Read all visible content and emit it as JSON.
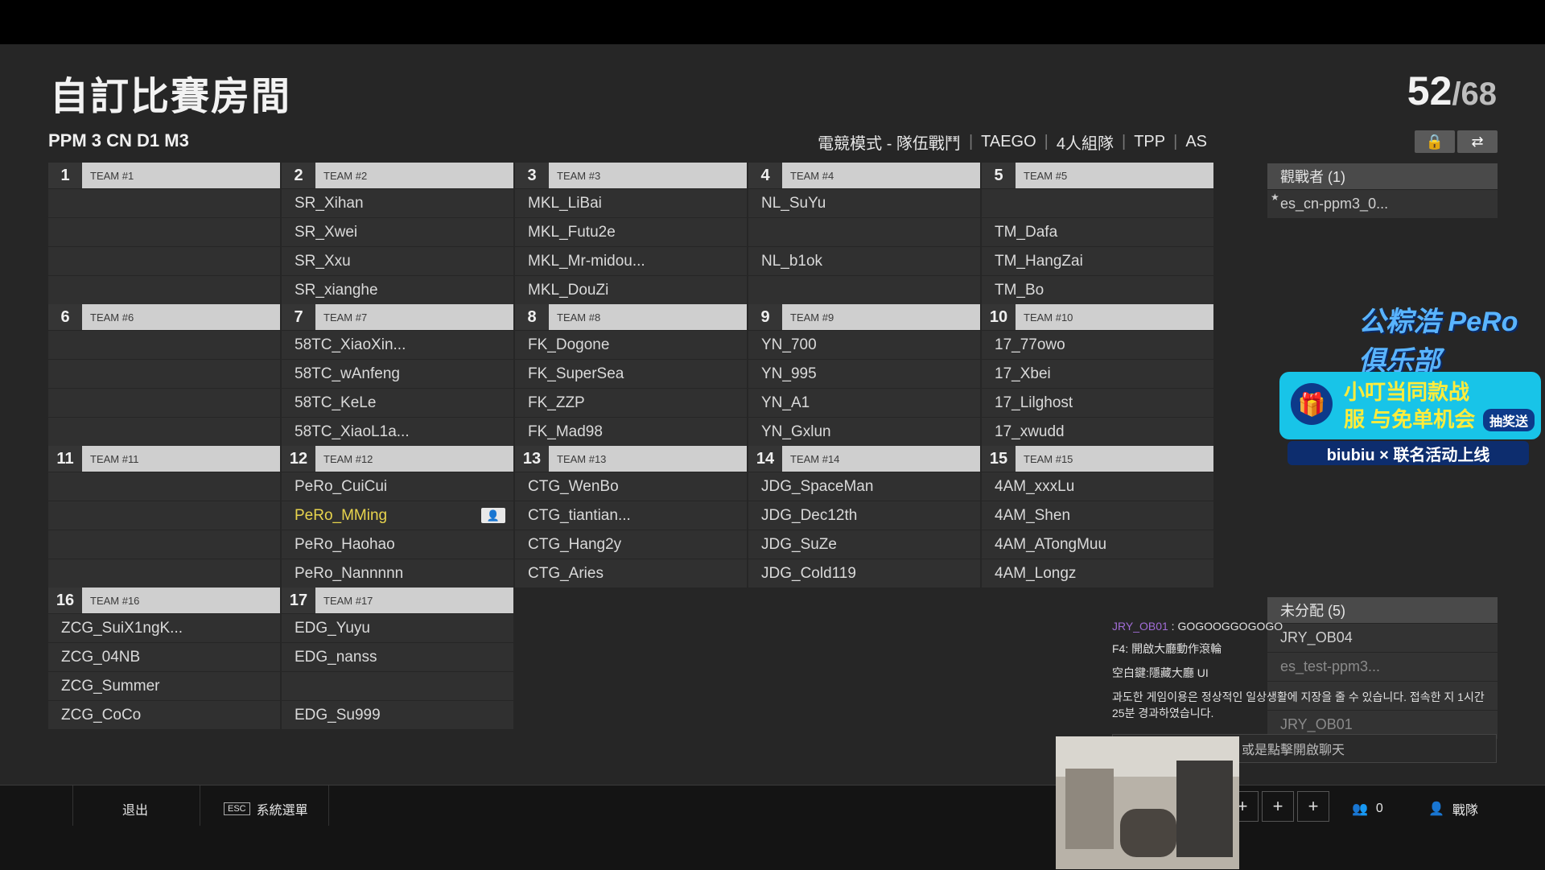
{
  "header": {
    "title": "自訂比賽房間",
    "room_code": "PPM 3 CN D1 M3",
    "player_count": "52",
    "player_max": "/68",
    "mode_items": [
      "電競模式 - 隊伍戰鬥",
      "TAEGO",
      "4人組隊",
      "TPP",
      "AS"
    ]
  },
  "teams": [
    {
      "num": "1",
      "name": "TEAM #1",
      "players": [
        "",
        "",
        "",
        ""
      ]
    },
    {
      "num": "2",
      "name": "TEAM #2",
      "players": [
        "SR_Xihan",
        "SR_Xwei",
        "SR_Xxu",
        "SR_xianghe"
      ]
    },
    {
      "num": "3",
      "name": "TEAM #3",
      "players": [
        "MKL_LiBai",
        "MKL_Futu2e",
        "MKL_Mr-midou...",
        "MKL_DouZi"
      ]
    },
    {
      "num": "4",
      "name": "TEAM #4",
      "players": [
        "NL_SuYu",
        "",
        "NL_b1ok",
        ""
      ]
    },
    {
      "num": "5",
      "name": "TEAM #5",
      "players": [
        "",
        "TM_Dafa",
        "TM_HangZai",
        "TM_Bo"
      ]
    },
    {
      "num": "6",
      "name": "TEAM #6",
      "players": [
        "",
        "",
        "",
        ""
      ]
    },
    {
      "num": "7",
      "name": "TEAM #7",
      "players": [
        "58TC_XiaoXin...",
        "58TC_wAnfeng",
        "58TC_KeLe",
        "58TC_XiaoL1a..."
      ]
    },
    {
      "num": "8",
      "name": "TEAM #8",
      "players": [
        "FK_Dogone",
        "FK_SuperSea",
        "FK_ZZP",
        "FK_Mad98"
      ]
    },
    {
      "num": "9",
      "name": "TEAM #9",
      "players": [
        "YN_700",
        "YN_995",
        "YN_A1",
        "YN_Gxlun"
      ]
    },
    {
      "num": "10",
      "name": "TEAM #10",
      "players": [
        "17_77owo",
        "17_Xbei",
        "17_Lilghost",
        "17_xwudd"
      ]
    },
    {
      "num": "11",
      "name": "TEAM #11",
      "players": [
        "",
        "",
        "",
        ""
      ]
    },
    {
      "num": "12",
      "name": "TEAM #12",
      "players": [
        "PeRo_CuiCui",
        "PeRo_MMing",
        "PeRo_Haohao",
        "PeRo_Nannnnn"
      ]
    },
    {
      "num": "13",
      "name": "TEAM #13",
      "players": [
        "CTG_WenBo",
        "CTG_tiantian...",
        "CTG_Hang2y",
        "CTG_Aries"
      ]
    },
    {
      "num": "14",
      "name": "TEAM #14",
      "players": [
        "JDG_SpaceMan",
        "JDG_Dec12th",
        "JDG_SuZe",
        "JDG_Cold119"
      ]
    },
    {
      "num": "15",
      "name": "TEAM #15",
      "players": [
        "4AM_xxxLu",
        "4AM_Shen",
        "4AM_ATongMuu",
        "4AM_Longz"
      ]
    },
    {
      "num": "16",
      "name": "TEAM #16",
      "players": [
        "ZCG_SuiX1ngK...",
        "ZCG_04NB",
        "ZCG_Summer",
        "ZCG_CoCo"
      ]
    },
    {
      "num": "17",
      "name": "TEAM #17",
      "players": [
        "EDG_Yuyu",
        "EDG_nanss",
        "",
        "EDG_Su999"
      ]
    }
  ],
  "spectators": {
    "title": "觀戰者 (1)",
    "items": [
      "es_cn-ppm3_0..."
    ]
  },
  "unassigned": {
    "title": "未分配 (5)",
    "items": [
      "JRY_OB04",
      "es_test-ppm3...",
      "",
      "JRY_OB01"
    ]
  },
  "chat": {
    "sender": "JRY_OB01",
    "message": "GOGOOGGOGOGO",
    "hint1": "F4: 開啟大廳動作滾輪",
    "hint2": "空白鍵:隱藏大廳 UI",
    "warning": "과도한 게임이용은 정상적인 일상생활에 지장을 줄 수 있습니다. 접속한 지 1시간 25분 경과하였습니다.",
    "input_hint": "或是點擊開啟聊天"
  },
  "footer": {
    "exit": "退出",
    "esc_key": "ESC",
    "system_menu": "系統選單",
    "friend_count": "0",
    "squad": "戰隊"
  },
  "overlay": {
    "club": "公粽浩 PeRo俱乐部",
    "promo": "小叮当同款战服 与免单机会",
    "promo_btn": "抽奖送",
    "collab": "biubiu × 联名活动上线"
  }
}
